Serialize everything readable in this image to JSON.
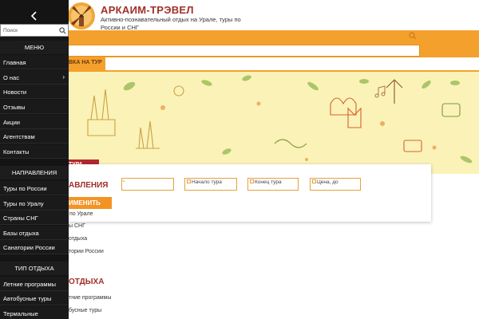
{
  "header": {
    "brand": "АРКАИМ-ТРЭВЕЛ",
    "tagline": "Активно-познавательный отдых на Урале, туры по России и СНГ",
    "search_value": "",
    "subnav_label": "ВКА НА ТУР"
  },
  "filter": {
    "ribbon_label": "ТУРА",
    "title": "АВЛЕНИЯ",
    "field_1": "",
    "field_2": "Начало тура",
    "field_3": "Конец тура",
    "field_4": "Цена, до",
    "apply_label": "ИМЕНИТЬ",
    "sub_label": "по Урале"
  },
  "content": {
    "links_1": [
      "ы СНГ",
      "отдыха",
      "тории России"
    ],
    "heading": "ОТДЫХА",
    "links_2": [
      "тние программы",
      "бусные туры"
    ]
  },
  "sidebar": {
    "search_placeholder": "Поиск",
    "menu_header": "МЕНЮ",
    "menu_items": [
      "Главная",
      "О нас",
      "Новости",
      "Отзывы",
      "Акции",
      "Агентствам",
      "Контакты"
    ],
    "directions_header": "НАПРАВЛЕНИЯ",
    "directions_items": [
      "Туры по России",
      "Туры по Уралу",
      "Страны СНГ",
      "Базы отдыха",
      "Санатории России"
    ],
    "rest_header": "ТИП ОТДЫХА",
    "rest_items": [
      "Летние программы",
      "Автобусные туры",
      "Термальные"
    ]
  },
  "colors": {
    "accent_orange": "#f4a02c",
    "brand_red": "#a0302a",
    "sidebar_bg": "#141414",
    "hero_bg": "#fbf2b8"
  },
  "icons": {
    "back": "chevron-left-icon",
    "search": "search-icon",
    "submenu": "chevron-right-icon",
    "logo": "windmill-logo-icon"
  }
}
